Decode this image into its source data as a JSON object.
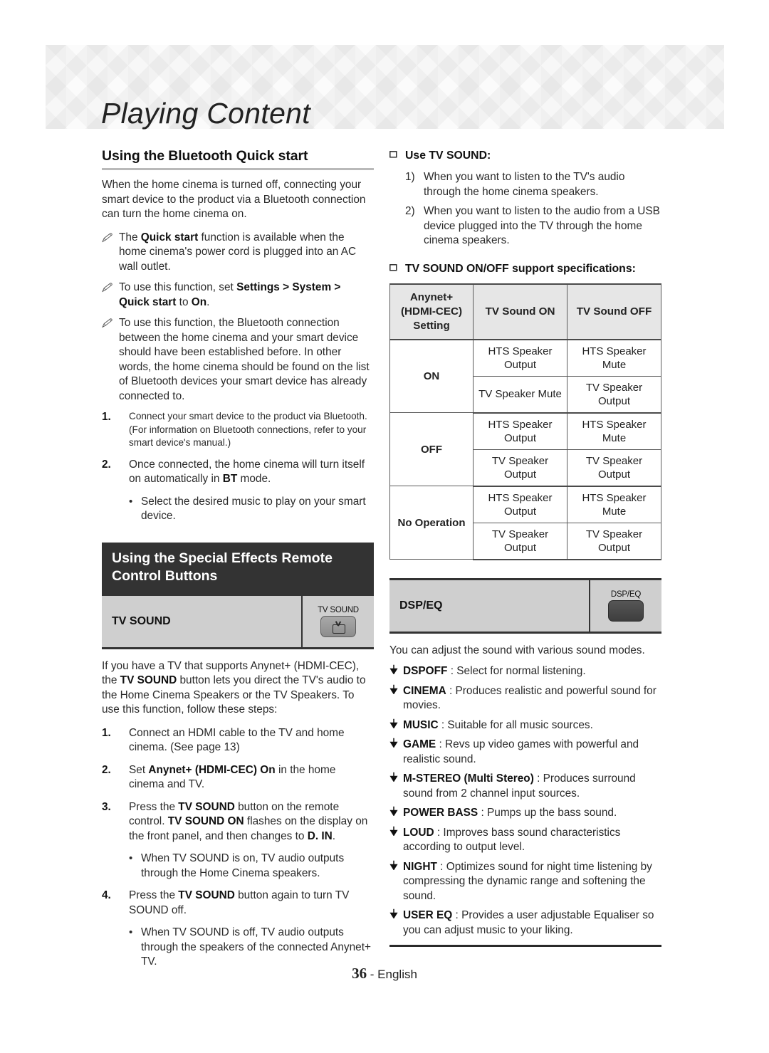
{
  "header": {
    "title": "Playing Content",
    "pattern": "geometric-triangles"
  },
  "left": {
    "section1": {
      "title": "Using the Bluetooth Quick start",
      "intro": "When the home cinema is turned off, connecting your smart device to the product via a Bluetooth connection can turn the home cinema on.",
      "notes": [
        {
          "icon": "note-pencil-icon",
          "pre": "The ",
          "bold1": "Quick start",
          "mid": " function is available when the home cinema's power cord is plugged into an AC wall outlet."
        },
        {
          "icon": "note-pencil-icon",
          "pre": "To use this function, set ",
          "bold1": "Settings > System > Quick start",
          "mid": " to ",
          "bold2": "On",
          "post": "."
        },
        {
          "icon": "note-pencil-icon",
          "pre": "To use this function, the Bluetooth connection between the home cinema and your smart device should have been established before. In other words, the home cinema should be found on the list of Bluetooth devices your smart device has already connected to."
        }
      ],
      "steps": [
        {
          "num": "1.",
          "text": "Connect your smart device to the product via Bluetooth. (For information on Bluetooth connections, refer to your smart device's manual.)"
        },
        {
          "num": "2.",
          "pre": "Once connected, the home cinema will turn itself on automatically in ",
          "bold": "BT",
          "post": " mode."
        }
      ],
      "sub_bullet": "Select the desired music to play on your smart device."
    },
    "section2": {
      "title": "Using the Special Effects Remote Control Buttons",
      "button_box": {
        "label": "TV SOUND",
        "key_label": "TV SOUND",
        "key_icon": "tv-icon"
      },
      "intro_pre": "If you have a TV that supports Anynet+ (HDMI-CEC), the ",
      "intro_bold": "TV SOUND",
      "intro_post": " button lets you direct the TV's audio to the Home Cinema Speakers or the TV Speakers. To use this function, follow these steps:",
      "steps": [
        {
          "num": "1.",
          "text": "Connect an HDMI cable to the TV and home cinema. (See page 13)"
        },
        {
          "num": "2.",
          "pre": "Set ",
          "bold": "Anynet+ (HDMI-CEC) On",
          "post": " in the home cinema and TV."
        },
        {
          "num": "3.",
          "pre": "Press the ",
          "bold1": "TV SOUND",
          "mid1": " button on the remote control. ",
          "bold2": "TV SOUND ON",
          "mid2": " flashes on the display on the front panel, and then changes to ",
          "bold3": "D. IN",
          "post": ".",
          "bullet": "When TV SOUND is on, TV audio outputs through the Home Cinema speakers."
        },
        {
          "num": "4.",
          "pre": "Press the ",
          "bold1": "TV SOUND",
          "mid1": " button again to turn TV SOUND off.",
          "bullet": "When TV SOUND is off, TV audio outputs through the speakers of the connected Anynet+ TV."
        }
      ]
    }
  },
  "right": {
    "use_tv_sound": {
      "heading": "Use TV SOUND:",
      "heading_icon": "square-bullet-icon",
      "items": [
        {
          "num": "1)",
          "text": "When you want to listen to the TV's audio through the home cinema speakers."
        },
        {
          "num": "2)",
          "text": "When you want to listen to the audio from a USB device plugged into the TV through the home cinema speakers."
        }
      ]
    },
    "spec_heading": "TV SOUND ON/OFF support specifications:",
    "spec_heading_icon": "square-bullet-icon",
    "table": {
      "headers": [
        "Anynet+ (HDMI-CEC) Setting",
        "TV Sound ON",
        "TV Sound OFF"
      ],
      "header_line1": "Anynet+",
      "header_line2": "(HDMI-CEC)",
      "header_line3": "Setting",
      "groups": [
        {
          "setting": "ON",
          "rows": [
            {
              "on": "HTS Speaker Output",
              "off": "HTS Speaker Mute"
            },
            {
              "on": "TV Speaker Mute",
              "off": "TV Speaker Output"
            }
          ]
        },
        {
          "setting": "OFF",
          "rows": [
            {
              "on": "HTS Speaker Output",
              "off": "HTS Speaker Mute"
            },
            {
              "on": "TV Speaker Output",
              "off": "TV Speaker Output"
            }
          ]
        },
        {
          "setting": "No Operation",
          "rows": [
            {
              "on": "HTS Speaker Output",
              "off": "HTS Speaker Mute"
            },
            {
              "on": "TV Speaker Output",
              "off": "TV Speaker Output"
            }
          ]
        }
      ]
    },
    "dspeq": {
      "button_box": {
        "label": "DSP/EQ",
        "key_label": "DSP/EQ",
        "key_icon": "blank-key-icon"
      },
      "intro": "You can adjust the sound with various sound modes.",
      "modes": [
        {
          "icon": "down-arrow-bullet-icon",
          "name": "DSPOFF",
          "desc": " : Select for normal listening."
        },
        {
          "icon": "down-arrow-bullet-icon",
          "name": "CINEMA",
          "desc": " : Produces realistic and powerful sound for movies."
        },
        {
          "icon": "down-arrow-bullet-icon",
          "name": "MUSIC",
          "desc": " : Suitable for all music sources."
        },
        {
          "icon": "down-arrow-bullet-icon",
          "name": "GAME",
          "desc": " : Revs up video games with powerful and realistic sound."
        },
        {
          "icon": "down-arrow-bullet-icon",
          "name": "M-STEREO (Multi Stereo)",
          "desc": " : Produces surround sound from 2 channel input sources."
        },
        {
          "icon": "down-arrow-bullet-icon",
          "name": "POWER BASS",
          "desc": " : Pumps up the bass sound."
        },
        {
          "icon": "down-arrow-bullet-icon",
          "name": "LOUD",
          "desc": " : Improves bass sound characteristics according to output level."
        },
        {
          "icon": "down-arrow-bullet-icon",
          "name": "NIGHT",
          "desc": " : Optimizes sound for night time listening by compressing the dynamic range and softening the sound."
        },
        {
          "icon": "down-arrow-bullet-icon",
          "name": "USER EQ",
          "desc": " : Provides a user adjustable Equaliser so you can adjust music to your liking."
        }
      ]
    }
  },
  "footer": {
    "page_number": "36",
    "separator": " - ",
    "language": "English"
  },
  "glyphs": {
    "note_pencil": "✎",
    "square_bullet": "❑",
    "down_arrow": "✦",
    "round_dot": "•"
  },
  "colors": {
    "dark_header_bg": "#333333",
    "grey_box_bg": "#cfcfcf",
    "table_header_bg": "#e6e6e6",
    "rule_grey": "#b9b9b9",
    "text": "#2a2a2a"
  }
}
